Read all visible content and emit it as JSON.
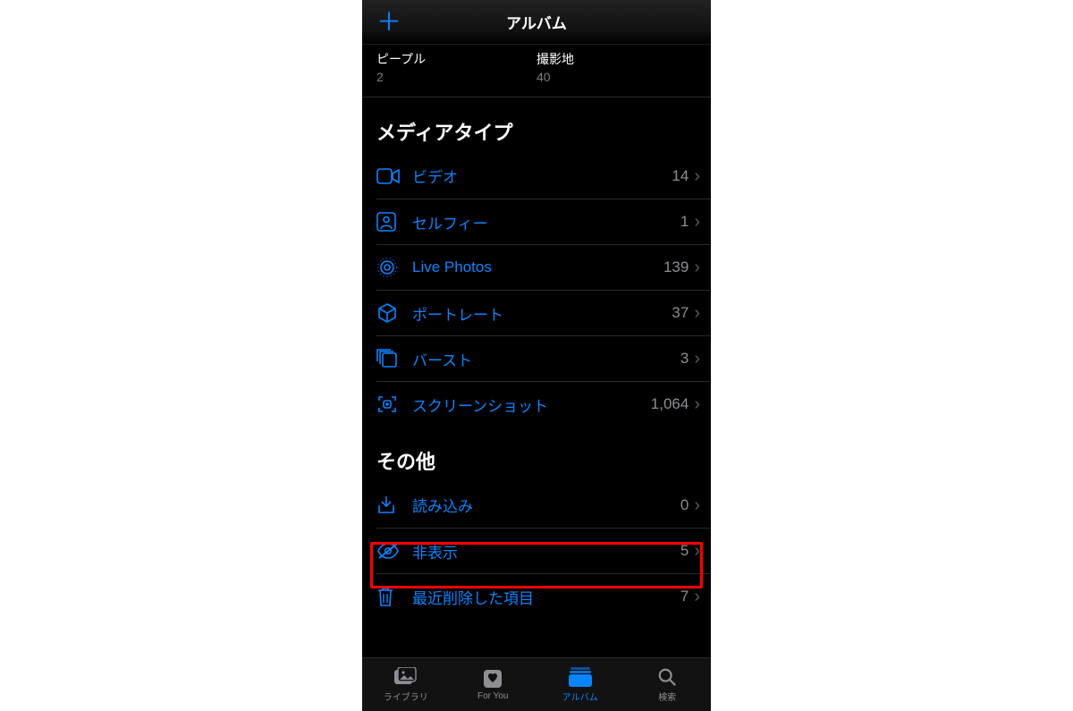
{
  "nav": {
    "title": "アルバム"
  },
  "topAlbums": [
    {
      "name": "ピープル",
      "count": "2"
    },
    {
      "name": "撮影地",
      "count": "40"
    }
  ],
  "sections": {
    "media": {
      "header": "メディアタイプ",
      "items": [
        {
          "label": "ビデオ",
          "count": "14"
        },
        {
          "label": "セルフィー",
          "count": "1"
        },
        {
          "label": "Live Photos",
          "count": "139"
        },
        {
          "label": "ポートレート",
          "count": "37"
        },
        {
          "label": "バースト",
          "count": "3"
        },
        {
          "label": "スクリーンショット",
          "count": "1,064"
        }
      ]
    },
    "other": {
      "header": "その他",
      "items": [
        {
          "label": "読み込み",
          "count": "0"
        },
        {
          "label": "非表示",
          "count": "5"
        },
        {
          "label": "最近削除した項目",
          "count": "7"
        }
      ]
    }
  },
  "tabs": [
    {
      "label": "ライブラリ"
    },
    {
      "label": "For You"
    },
    {
      "label": "アルバム"
    },
    {
      "label": "検索"
    }
  ]
}
